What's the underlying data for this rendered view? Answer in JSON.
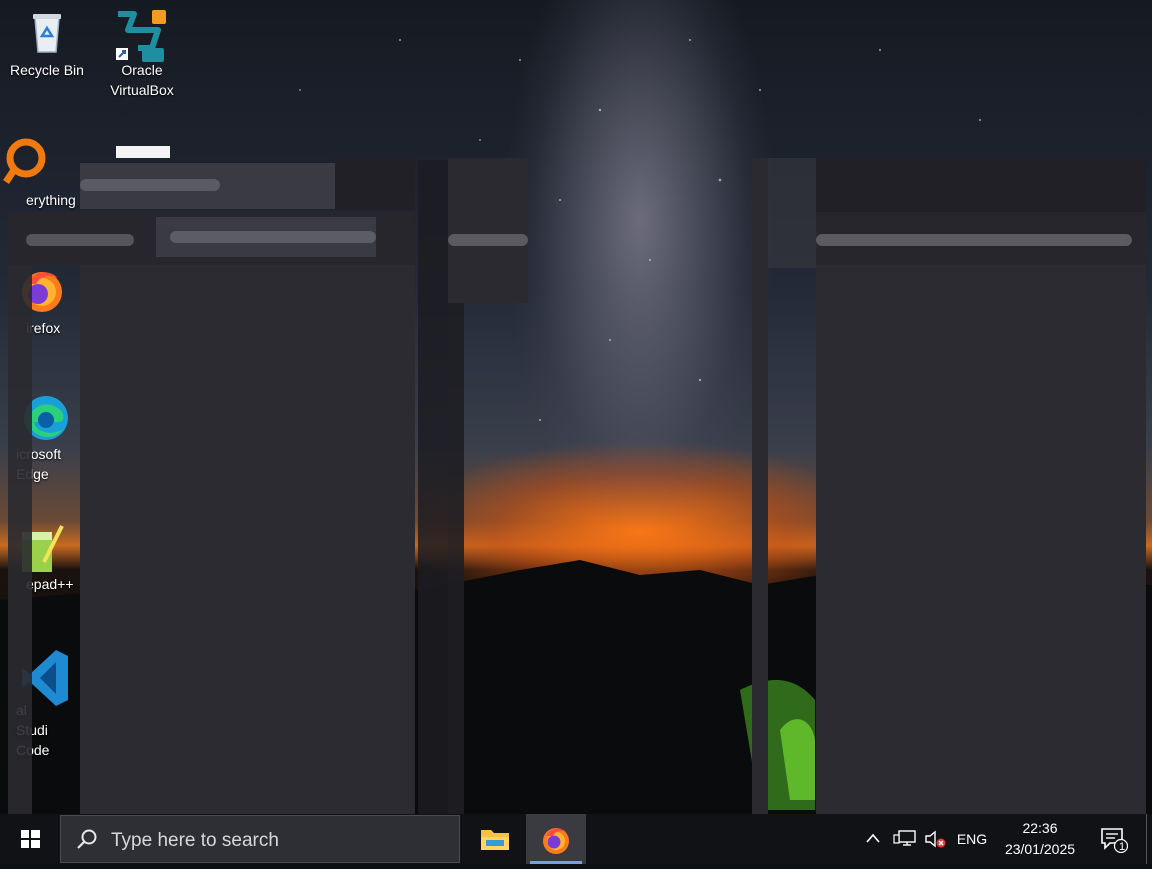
{
  "desktop": {
    "icons": [
      {
        "label": "Recycle Bin"
      },
      {
        "label": "Oracle VirtualBox"
      },
      {
        "label": "erything"
      },
      {
        "label": "irefox"
      },
      {
        "label": "icrosoft Edge"
      },
      {
        "label": "epad++"
      },
      {
        "label": "al Studi Code"
      }
    ]
  },
  "taskbar": {
    "search_placeholder": "Type here to search",
    "language": "ENG",
    "time": "22:36",
    "date": "23/01/2025",
    "notification_count": "1",
    "icons": [
      "windows-start-icon",
      "search-icon",
      "file-explorer-icon",
      "firefox-icon",
      "chevron-up-icon",
      "network-icon",
      "volume-muted-icon",
      "action-center-icon"
    ]
  },
  "colors": {
    "taskbar_bg": "#111216",
    "window_bg": "#2b2b31",
    "accent": "#7a9fe0"
  }
}
